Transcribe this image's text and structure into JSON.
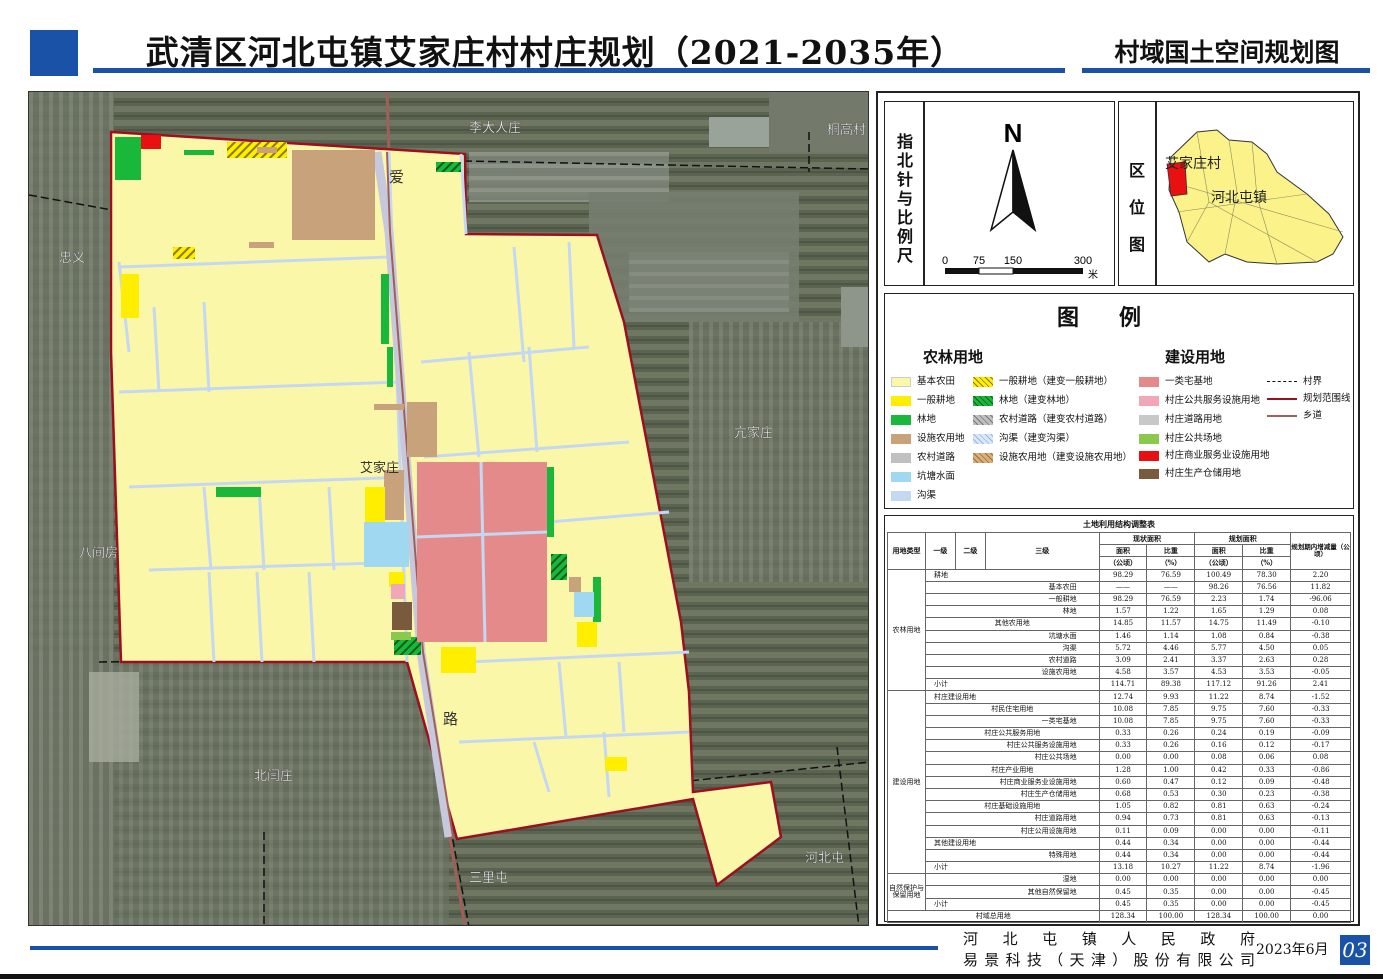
{
  "header": {
    "title": "武清区河北屯镇艾家庄村村庄规划（2021-2035年）",
    "subtitle": "村域国土空间规划图"
  },
  "map": {
    "place_labels": {
      "li_da_ren_zhuang": "李大人庄",
      "tong_gao_cun": "桐高村",
      "zhong_yi": "忠义",
      "ai": "爱",
      "kang_jia_zhuang": "亢家庄",
      "ai_jia_zhuang": "艾家庄",
      "ba_jian_fang": "八间房",
      "lu": "路",
      "bei_yan_zhuang": "北闫庄",
      "san_li_tun": "三里屯",
      "he_bei_tun": "河北屯"
    }
  },
  "north_arrow": {
    "label": "指北针与比例尺",
    "north_letter": "N",
    "scale_ticks": [
      "0",
      "75",
      "150",
      "300"
    ],
    "scale_unit": "米"
  },
  "location_map": {
    "label": "区位图",
    "village": "艾家庄村",
    "town": "河北屯镇"
  },
  "legend": {
    "title": "图例",
    "agri_heading": "农林用地",
    "build_heading": "建设用地",
    "items": {
      "basic_farmland": "基本农田",
      "general_farmland": "一般耕地",
      "forest": "林地",
      "facility_agri": "设施农用地",
      "rural_road": "农村道路",
      "pond": "坑塘水面",
      "ditch": "沟渠",
      "general_farmland_change": "一般耕地（建变一般耕地）",
      "forest_change": "林地（建变林地）",
      "rural_road_change": "农村道路（建变农村道路）",
      "ditch_change": "沟渠（建变沟渠）",
      "facility_change": "设施农用地（建变设施农用地）",
      "residential": "一类宅基地",
      "public_service": "村庄公共服务设施用地",
      "village_road": "村庄道路用地",
      "public_square": "村庄公共场地",
      "commercial": "村庄商业服务业设施用地",
      "warehouse": "村庄生产仓储用地",
      "village_boundary": "村界",
      "plan_boundary": "规划范围线",
      "township_road": "乡道"
    }
  },
  "table": {
    "title": "土地利用结构调整表",
    "headers": {
      "land_type": "用地类型",
      "level1": "一级",
      "level2": "二级",
      "level3": "三级",
      "current_area": "现状面积",
      "planned_area": "规划面积",
      "area": "面积",
      "area_unit": "（公顷）",
      "ratio": "比重",
      "ratio_unit": "（%）",
      "change": "规划期内增减量（公顷）"
    },
    "group_labels": {
      "agri": "农林用地",
      "build": "建设用地",
      "nature": "自然保护与保留用地"
    },
    "rows": [
      {
        "name": "耕地",
        "c_area": "98.29",
        "c_ratio": "76.59",
        "p_area": "100.49",
        "p_ratio": "78.30",
        "change": "2.20"
      },
      {
        "name": "基本农田",
        "c_area": "——",
        "c_ratio": "——",
        "p_area": "98.26",
        "p_ratio": "76.56",
        "change": "11.82"
      },
      {
        "name": "一般耕地",
        "c_area": "98.29",
        "c_ratio": "76.59",
        "p_area": "2.23",
        "p_ratio": "1.74",
        "change": "-96.06"
      },
      {
        "name": "林地",
        "c_area": "1.57",
        "c_ratio": "1.22",
        "p_area": "1.65",
        "p_ratio": "1.29",
        "change": "0.08"
      },
      {
        "name": "其他农用地",
        "c_area": "14.85",
        "c_ratio": "11.57",
        "p_area": "14.75",
        "p_ratio": "11.49",
        "change": "-0.10"
      },
      {
        "name": "坑塘水面",
        "c_area": "1.46",
        "c_ratio": "1.14",
        "p_area": "1.08",
        "p_ratio": "0.84",
        "change": "-0.38"
      },
      {
        "name": "沟渠",
        "c_area": "5.72",
        "c_ratio": "4.46",
        "p_area": "5.77",
        "p_ratio": "4.50",
        "change": "0.05"
      },
      {
        "name": "农村道路",
        "c_area": "3.09",
        "c_ratio": "2.41",
        "p_area": "3.37",
        "p_ratio": "2.63",
        "change": "0.28"
      },
      {
        "name": "设施农用地",
        "c_area": "4.58",
        "c_ratio": "3.57",
        "p_area": "4.53",
        "p_ratio": "3.53",
        "change": "-0.05"
      },
      {
        "name": "小计",
        "c_area": "114.71",
        "c_ratio": "89.38",
        "p_area": "117.12",
        "p_ratio": "91.26",
        "change": "2.41"
      },
      {
        "name": "村庄建设用地",
        "c_area": "12.74",
        "c_ratio": "9.93",
        "p_area": "11.22",
        "p_ratio": "8.74",
        "change": "-1.52"
      },
      {
        "name": "村民住宅用地",
        "c_area": "10.08",
        "c_ratio": "7.85",
        "p_area": "9.75",
        "p_ratio": "7.60",
        "change": "-0.33"
      },
      {
        "name": "一类宅基地",
        "c_area": "10.08",
        "c_ratio": "7.85",
        "p_area": "9.75",
        "p_ratio": "7.60",
        "change": "-0.33"
      },
      {
        "name": "村庄公共服务用地",
        "c_area": "0.33",
        "c_ratio": "0.26",
        "p_area": "0.24",
        "p_ratio": "0.19",
        "change": "-0.09"
      },
      {
        "name": "村庄公共服务设施用地",
        "c_area": "0.33",
        "c_ratio": "0.26",
        "p_area": "0.16",
        "p_ratio": "0.12",
        "change": "-0.17"
      },
      {
        "name": "村庄公共场地",
        "c_area": "0.00",
        "c_ratio": "0.00",
        "p_area": "0.08",
        "p_ratio": "0.06",
        "change": "0.08"
      },
      {
        "name": "村庄产业用地",
        "c_area": "1.28",
        "c_ratio": "1.00",
        "p_area": "0.42",
        "p_ratio": "0.33",
        "change": "-0.86"
      },
      {
        "name": "村庄商业服务业设施用地",
        "c_area": "0.60",
        "c_ratio": "0.47",
        "p_area": "0.12",
        "p_ratio": "0.09",
        "change": "-0.48"
      },
      {
        "name": "村庄生产仓储用地",
        "c_area": "0.68",
        "c_ratio": "0.53",
        "p_area": "0.30",
        "p_ratio": "0.23",
        "change": "-0.38"
      },
      {
        "name": "村庄基础设施用地",
        "c_area": "1.05",
        "c_ratio": "0.82",
        "p_area": "0.81",
        "p_ratio": "0.63",
        "change": "-0.24"
      },
      {
        "name": "村庄道路用地",
        "c_area": "0.94",
        "c_ratio": "0.73",
        "p_area": "0.81",
        "p_ratio": "0.63",
        "change": "-0.13"
      },
      {
        "name": "村庄公用设施用地",
        "c_area": "0.11",
        "c_ratio": "0.09",
        "p_area": "0.00",
        "p_ratio": "0.00",
        "change": "-0.11"
      },
      {
        "name": "其他建设用地",
        "c_area": "0.44",
        "c_ratio": "0.34",
        "p_area": "0.00",
        "p_ratio": "0.00",
        "change": "-0.44"
      },
      {
        "name": "特殊用地",
        "c_area": "0.44",
        "c_ratio": "0.34",
        "p_area": "0.00",
        "p_ratio": "0.00",
        "change": "-0.44"
      },
      {
        "name": "小计",
        "c_area": "13.18",
        "c_ratio": "10.27",
        "p_area": "11.22",
        "p_ratio": "8.74",
        "change": "-1.96"
      },
      {
        "name": "湿地",
        "c_area": "0.00",
        "c_ratio": "0.00",
        "p_area": "0.00",
        "p_ratio": "0.00",
        "change": "0.00"
      },
      {
        "name": "其他自然保留地",
        "c_area": "0.45",
        "c_ratio": "0.35",
        "p_area": "0.00",
        "p_ratio": "0.00",
        "change": "-0.45"
      },
      {
        "name": "小计",
        "c_area": "0.45",
        "c_ratio": "0.35",
        "p_area": "0.00",
        "p_ratio": "0.00",
        "change": "-0.45"
      },
      {
        "name": "村域总用地",
        "c_area": "128.34",
        "c_ratio": "100.00",
        "p_area": "128.34",
        "p_ratio": "100.00",
        "change": "0.00"
      }
    ]
  },
  "footer": {
    "government": "河北屯镇人民政府",
    "company": "易景科技（天津）股份有限公司",
    "date": "2023年6月",
    "page": "03"
  },
  "colors": {
    "brand_blue": "#1a52a8",
    "basic_farmland": "#fbf7a8",
    "general_farmland": "#ffee00",
    "forest": "#1ab83a",
    "facility_agri": "#c8a27a",
    "rural_road": "#c0c0c0",
    "pond": "#9fd8f0",
    "ditch": "#c4d8f2",
    "residential": "#e58a8a",
    "public_service": "#f2a7b8",
    "village_road": "#c8c8c8",
    "public_square": "#8cc84e",
    "commercial": "#e81010",
    "warehouse": "#7a5a3c",
    "plan_boundary": "#9a1020",
    "township_road": "#a0605a"
  }
}
